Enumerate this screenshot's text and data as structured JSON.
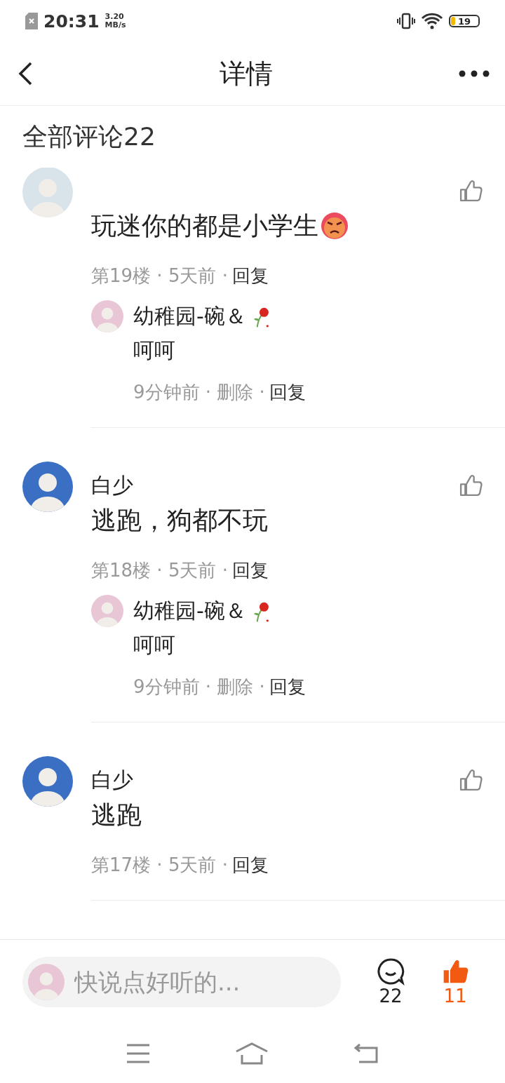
{
  "status_bar": {
    "time": "20:31",
    "net_speed": [
      "3.20",
      "MB/s"
    ],
    "battery": "19"
  },
  "header": {
    "title": "详情"
  },
  "comments_heading": "全部评论22",
  "comments": [
    {
      "color": "#d8e3ea",
      "liked": false,
      "body": "玩迷你的都是小学生",
      "emoji": {
        "kind": "angry"
      },
      "meta": "第19楼 · 5天前 ·",
      "reply_link": "回复",
      "replies": [
        {
          "author": "幼稚园-碗＆",
          "emoji": {
            "kind": "rose"
          },
          "text": "呵呵",
          "meta": "9分钟前 · 删除 ·",
          "reply_link": "回复"
        }
      ]
    },
    {
      "color": "#3a6fc4",
      "liked": false,
      "author": "白少",
      "body": "逃跑，狗都不玩",
      "meta": "第18楼 · 5天前 ·",
      "reply_link": "回复",
      "replies": [
        {
          "author": "幼稚园-碗＆",
          "emoji": {
            "kind": "rose"
          },
          "text": "呵呵",
          "meta": "9分钟前 · 删除 ·",
          "reply_link": "回复"
        }
      ]
    },
    {
      "color": "#3a6fc4",
      "liked": false,
      "author": "白少",
      "body": "逃跑",
      "meta": "第17楼 · 5天前 ·",
      "reply_link": "回复"
    }
  ],
  "bottom_bar": {
    "placeholder": "快说点好听的...",
    "comment_count": "22",
    "like_count": "11",
    "liked": true
  }
}
